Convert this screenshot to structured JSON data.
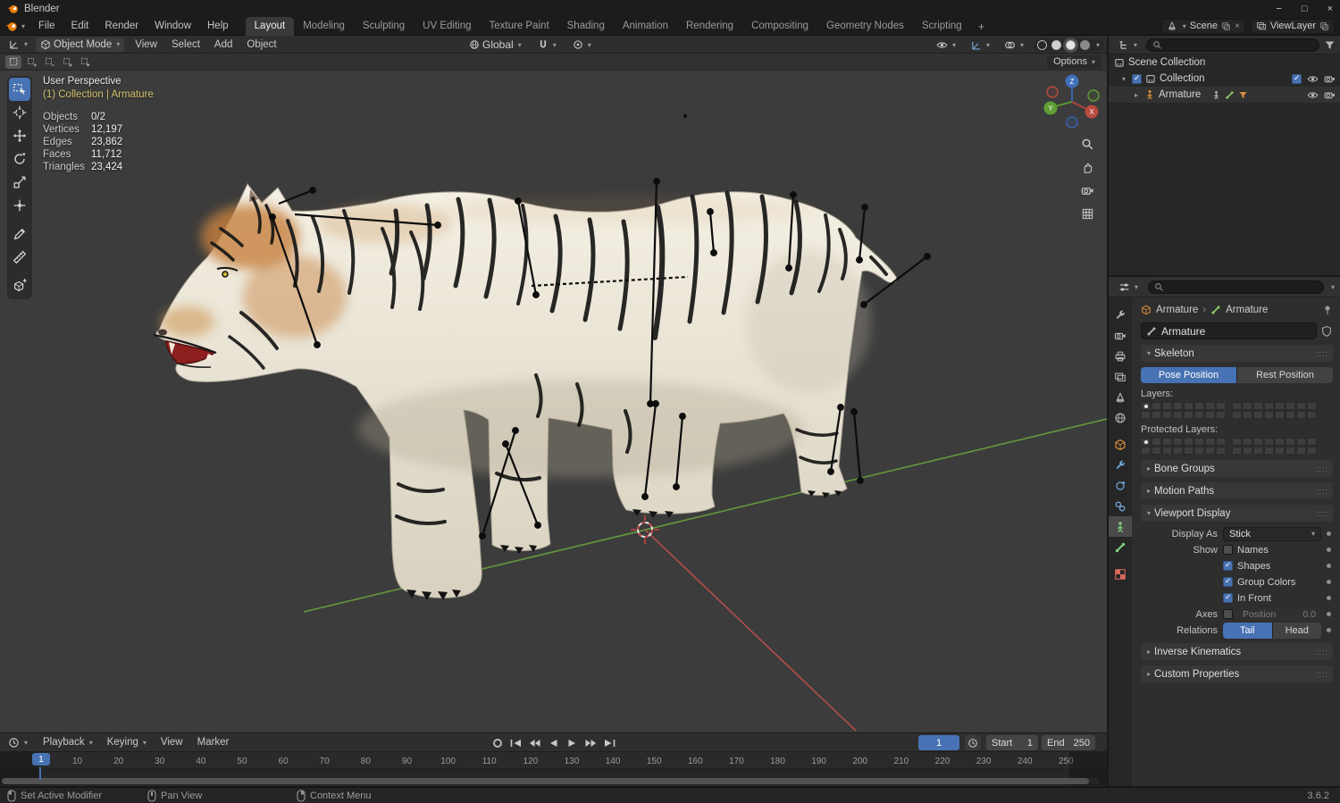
{
  "icons": {
    "caret_down": "▾",
    "caret_right": "▸",
    "chevron": "›",
    "minimize": "−",
    "maximize": "□",
    "close": "×",
    "drag": "::::"
  },
  "window": {
    "title": "Blender"
  },
  "menubar": {
    "menus": [
      "File",
      "Edit",
      "Render",
      "Window",
      "Help"
    ],
    "workspaces": [
      "Layout",
      "Modeling",
      "Sculpting",
      "UV Editing",
      "Texture Paint",
      "Shading",
      "Animation",
      "Rendering",
      "Compositing",
      "Geometry Nodes",
      "Scripting"
    ],
    "active_workspace": "Layout",
    "add_tab": "+",
    "scene_label": "Scene",
    "viewlayer_label": "ViewLayer"
  },
  "viewport": {
    "header": {
      "mode": "Object Mode",
      "menus": [
        "View",
        "Select",
        "Add",
        "Object"
      ],
      "orientation": "Global",
      "options": "Options"
    },
    "overlay": {
      "view_name": "User Perspective",
      "context_path": "(1) Collection | Armature",
      "stats": [
        {
          "label": "Objects",
          "value": "0/2"
        },
        {
          "label": "Vertices",
          "value": "12,197"
        },
        {
          "label": "Edges",
          "value": "23,862"
        },
        {
          "label": "Faces",
          "value": "11,712"
        },
        {
          "label": "Triangles",
          "value": "23,424"
        }
      ]
    },
    "gizmo": {
      "x": "X",
      "y": "Y",
      "z": "Z"
    }
  },
  "outliner": {
    "rows": [
      {
        "label": "Scene Collection"
      },
      {
        "label": "Collection"
      },
      {
        "label": "Armature"
      }
    ]
  },
  "properties": {
    "breadcrumb": {
      "object": "Armature",
      "data": "Armature"
    },
    "name_value": "Armature",
    "skeleton": {
      "title": "Skeleton",
      "pose": "Pose Position",
      "rest": "Rest Position",
      "layers_label": "Layers:",
      "protected_label": "Protected Layers:"
    },
    "collapsed": {
      "bone_groups": "Bone Groups",
      "motion_paths": "Motion Paths",
      "inverse_kinematics": "Inverse Kinematics",
      "custom_properties": "Custom Properties"
    },
    "viewport_display": {
      "title": "Viewport Display",
      "display_as_label": "Display As",
      "display_as_value": "Stick",
      "show_label": "Show",
      "checkboxes": [
        {
          "label": "Names",
          "checked": false
        },
        {
          "label": "Shapes",
          "checked": true
        },
        {
          "label": "Group Colors",
          "checked": true
        },
        {
          "label": "In Front",
          "checked": true
        }
      ],
      "axes_label": "Axes",
      "position_label": "Position",
      "position_value": "0.0",
      "relations_label": "Relations",
      "tail": "Tail",
      "head": "Head"
    }
  },
  "timeline": {
    "menus": [
      "Playback",
      "Keying",
      "View",
      "Marker"
    ],
    "current_frame": "1",
    "start_label": "Start",
    "start_value": "1",
    "end_label": "End",
    "end_value": "250",
    "ticks": [
      10,
      20,
      30,
      40,
      50,
      60,
      70,
      80,
      90,
      100,
      110,
      120,
      130,
      140,
      150,
      160,
      170,
      180,
      190,
      200,
      210,
      220,
      230,
      240,
      250
    ]
  },
  "statusbar": {
    "items": [
      "Set Active Modifier",
      "Pan View",
      "Context Menu"
    ],
    "version": "3.6.2"
  }
}
